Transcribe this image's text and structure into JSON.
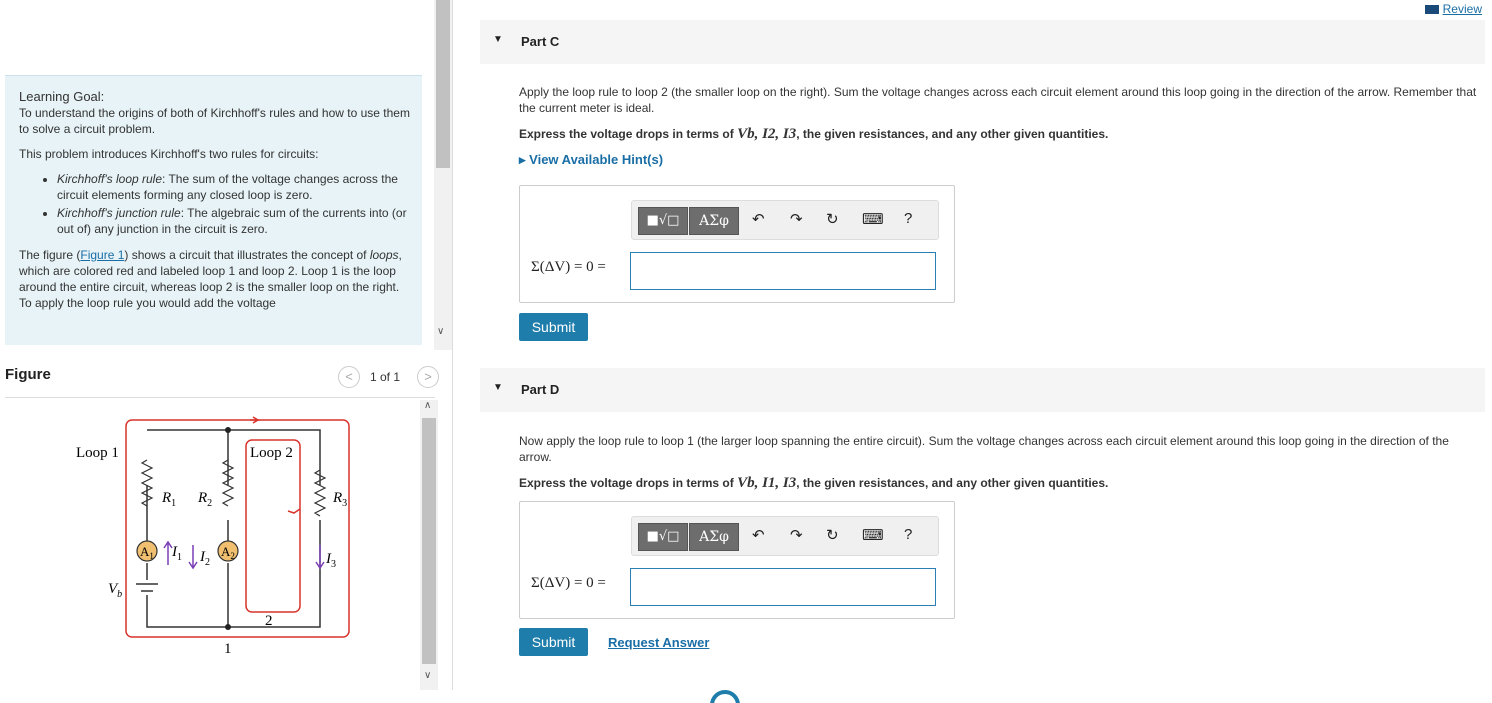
{
  "learning": {
    "goal_heading": "Learning Goal:",
    "goal_text": "To understand the origins of both of Kirchhoff's rules and how to use them to solve a circuit problem.",
    "intro": "This problem introduces Kirchhoff's two rules for circuits:",
    "rule1_name": "Kirchhoff's loop rule",
    "rule1_text": ": The sum of the voltage changes across the circuit elements forming any closed loop is zero.",
    "rule2_name": "Kirchhoff's junction rule",
    "rule2_text": ": The algebraic sum of the currents into (or out of) any junction in the circuit is zero.",
    "figure_para_pre": "The figure (",
    "figure_link": "Figure 1",
    "figure_para_mid": ") shows a circuit that illustrates the concept of ",
    "loops_word": "loops",
    "figure_para_post": ", which are colored red and labeled loop 1 and loop 2. Loop 1 is the loop around the entire circuit, whereas loop 2 is the smaller loop on the right. To apply the loop rule you would add the voltage"
  },
  "figure": {
    "title": "Figure",
    "pager": "1 of 1",
    "prev_icon": "chevron-left-icon",
    "next_icon": "chevron-right-icon",
    "labels": {
      "loop1": "Loop 1",
      "loop2": "Loop 2",
      "r1": "R",
      "r1_sub": "1",
      "r2": "R",
      "r2_sub": "2",
      "r3": "R",
      "r3_sub": "3",
      "a1": "A",
      "a1_sub": "1",
      "a2": "A",
      "a2_sub": "2",
      "i1": "I",
      "i1_sub": "1",
      "i2": "I",
      "i2_sub": "2",
      "i3": "I",
      "i3_sub": "3",
      "vb": "V",
      "vb_sub": "b",
      "node1": "1",
      "node2": "2"
    }
  },
  "review": {
    "label": "Review"
  },
  "partC": {
    "label": "Part C",
    "text": "Apply the loop rule to loop 2 (the smaller loop on the right). Sum the voltage changes across each circuit element around this loop going in the direction of the arrow. Remember that the current meter is ideal.",
    "express_pre": "Express the voltage drops in terms of ",
    "express_vars": "Vb, I2, I3",
    "express_post": ", the given resistances, and any other given quantities.",
    "hint": "View Available Hint(s)",
    "equation": "Σ(ΔV) = 0 =",
    "submit": "Submit"
  },
  "partD": {
    "label": "Part D",
    "text": "Now apply the loop rule to loop 1 (the larger loop spanning the entire circuit). Sum the voltage changes across each circuit element around this loop going in the direction of the arrow.",
    "express_pre": "Express the voltage drops in terms of ",
    "express_vars": "Vb, I1, I3",
    "express_post": ", the given resistances, and any other given quantities.",
    "equation": "Σ(ΔV) = 0 =",
    "submit": "Submit",
    "request": "Request Answer"
  },
  "toolbar": {
    "btn_templates": "■√□",
    "btn_symbols": "ΑΣφ",
    "undo": "↶",
    "redo": "↷",
    "reset": "↻",
    "keyboard": "⌨",
    "help": "?"
  }
}
